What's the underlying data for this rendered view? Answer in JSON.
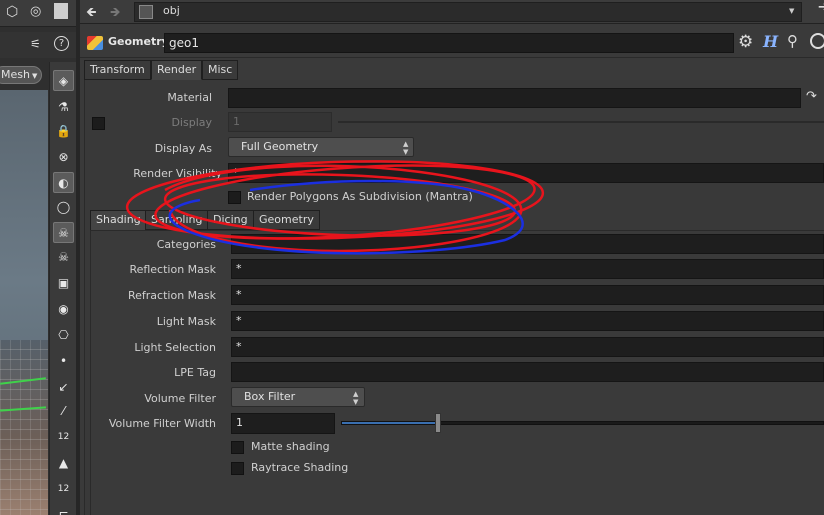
{
  "viewport": {
    "mesh_label": "Mesh",
    "tools": [
      {
        "name": "view-tool-icon"
      },
      {
        "name": "select-tool-icon"
      },
      {
        "name": "lock-icon"
      },
      {
        "name": "ghost-icon"
      },
      {
        "name": "light-icon"
      },
      {
        "name": "snap-icon"
      },
      {
        "name": "skull-icon"
      },
      {
        "name": "skull-alt-icon"
      },
      {
        "name": "display-icon"
      },
      {
        "name": "eye-icon"
      },
      {
        "name": "camera-icon"
      },
      {
        "name": "point-icon"
      },
      {
        "name": "arrow-icon"
      },
      {
        "name": "brush-icon"
      },
      {
        "name": "twelve-icon",
        "text": "12"
      },
      {
        "name": "paint-icon"
      },
      {
        "name": "twelve-alt-icon",
        "text": "12"
      },
      {
        "name": "spline-icon"
      }
    ]
  },
  "path_bar": {
    "path": "obj"
  },
  "header": {
    "node_type": "Geometry",
    "node_name": "geo1"
  },
  "top_tabs": [
    "Transform",
    "Render",
    "Misc"
  ],
  "render": {
    "material_label": "Material",
    "material_value": "",
    "display_label": "Display",
    "display_value": "1",
    "display_as_label": "Display As",
    "display_as_value": "Full Geometry",
    "render_visibility_label": "Render Visibility",
    "render_visibility_value": "*",
    "subdiv_label": "Render Polygons As Subdivision (Mantra)"
  },
  "sub_tabs": [
    "Shading",
    "Sampling",
    "Dicing",
    "Geometry"
  ],
  "shading": {
    "categories_label": "Categories",
    "categories_value": "",
    "reflection_mask_label": "Reflection Mask",
    "reflection_mask_value": "*",
    "refraction_mask_label": "Refraction Mask",
    "refraction_mask_value": "*",
    "light_mask_label": "Light Mask",
    "light_mask_value": "*",
    "light_selection_label": "Light Selection",
    "light_selection_value": "*",
    "lpe_tag_label": "LPE Tag",
    "lpe_tag_value": "",
    "volume_filter_label": "Volume Filter",
    "volume_filter_value": "Box Filter",
    "volume_filter_width_label": "Volume Filter Width",
    "volume_filter_width_value": "1",
    "volume_filter_width_slider": 0.2,
    "matte_label": "Matte shading",
    "raytrace_label": "Raytrace Shading"
  },
  "colors": {
    "annotation_red": "#e8141c",
    "annotation_blue": "#1b2fe0",
    "slider_blue": "#3a6fb0"
  }
}
